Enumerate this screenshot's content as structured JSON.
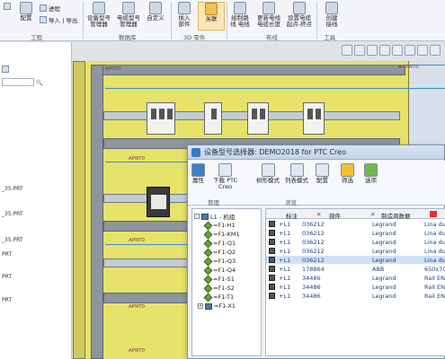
{
  "ribbon": {
    "buttons": [
      {
        "label": "配置",
        "icon": "config-icon"
      },
      {
        "label": "设备型号\n管理器",
        "icon": "device-model-manager-icon"
      },
      {
        "label": "电缆型号\n管理器",
        "icon": "cable-model-manager-icon"
      },
      {
        "label": "自定义",
        "icon": "customize-icon"
      },
      {
        "label": "插入\n部件",
        "icon": "insert-part-icon"
      },
      {
        "label": "关联",
        "icon": "associate-icon"
      },
      {
        "label": "绘制路\n线 电线",
        "icon": "draw-wire-icon"
      },
      {
        "label": "更新电线\n电缆长度",
        "icon": "update-length-icon"
      },
      {
        "label": "设置电缆\n起点-终点",
        "icon": "cable-endpoints-icon"
      },
      {
        "label": "创建\n接线",
        "icon": "create-wiring-icon"
      }
    ],
    "small_items": [
      "进程",
      "导入 | 导出"
    ],
    "groups": [
      "工程",
      "数据库",
      "3D 零件",
      "布线",
      "工具"
    ]
  },
  "left_panel": {
    "rows": [
      "_35.PRT",
      "_35.PRT",
      "_35.PRT",
      "PRT",
      "PRT",
      "PRT"
    ]
  },
  "canvas": {
    "labels": [
      "#APNT0",
      "APNT0",
      "APNT0",
      "APNT0",
      "APNT0",
      "APNT0"
    ]
  },
  "dialog": {
    "title": "设备型号选择器: DEMO2018 for PTC Creo",
    "buttons": [
      {
        "label": "属性",
        "icon": "info-icon"
      },
      {
        "label": "下载 PTC\nCreo",
        "icon": "download-icon"
      },
      {
        "label": "树形模式",
        "icon": "tree-mode-icon"
      },
      {
        "label": "列表模式",
        "icon": "list-mode-icon"
      },
      {
        "label": "配置",
        "icon": "config-icon"
      },
      {
        "label": "筛选",
        "icon": "filter-icon"
      },
      {
        "label": "选项",
        "icon": "options-icon"
      }
    ],
    "groups": [
      "管理",
      "浏览"
    ],
    "tree": {
      "root": "L1 - 机组",
      "items": [
        "=F1-H1",
        "=F1-KM1",
        "=F1-Q1",
        "=F1-Q2",
        "=F1-Q3",
        "=F1-Q4",
        "=F1-S1",
        "=F1-S2",
        "=F1-T1",
        "=F1-X1"
      ]
    },
    "grid": {
      "headers": [
        "标注",
        "部件",
        "制造商数据"
      ],
      "rows": [
        {
          "tag": "+L1",
          "part": "036212",
          "maker": "Legrand",
          "desc": "Lina duct 2"
        },
        {
          "tag": "+L1",
          "part": "036212",
          "maker": "Legrand",
          "desc": "Lina duct 2"
        },
        {
          "tag": "+L1",
          "part": "036212",
          "maker": "Legrand",
          "desc": "Lina duct 2"
        },
        {
          "tag": "+L1",
          "part": "036212",
          "maker": "Legrand",
          "desc": "Lina duct 2"
        },
        {
          "tag": "+L1",
          "part": "036212",
          "maker": "Legrand",
          "desc": "Lina duct 2"
        },
        {
          "tag": "+L1",
          "part": "178864",
          "maker": "ABB",
          "desc": "650x700x2"
        },
        {
          "tag": "+L1",
          "part": "34486",
          "maker": "Legrand",
          "desc": "Rail EN 500"
        },
        {
          "tag": "+L1",
          "part": "34486",
          "maker": "Legrand",
          "desc": "Rail EN 500"
        },
        {
          "tag": "+L1",
          "part": "34486",
          "maker": "Legrand",
          "desc": "Rail EN 500"
        }
      ]
    }
  }
}
